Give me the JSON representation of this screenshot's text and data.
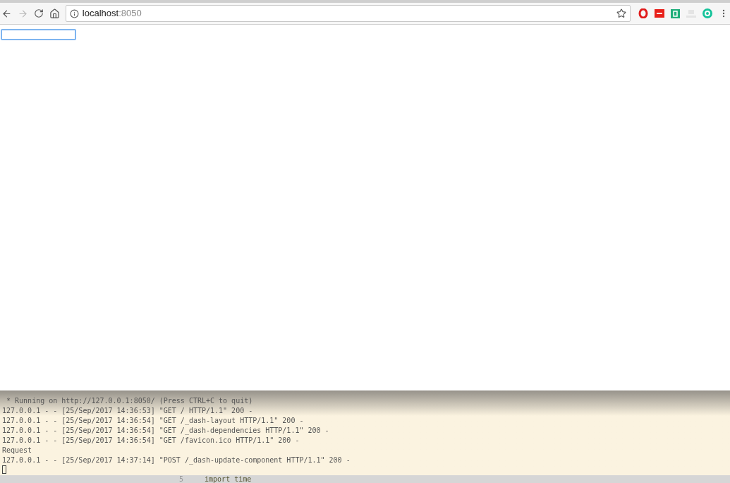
{
  "browser": {
    "address": {
      "host": "localhost",
      "port": ":8050"
    }
  },
  "page": {
    "input": {
      "focused": true
    }
  },
  "terminal": {
    "lines": [
      " * Running on http://127.0.0.1:8050/ (Press CTRL+C to quit)",
      "127.0.0.1 - - [25/Sep/2017 14:36:53] \"GET / HTTP/1.1\" 200 -",
      "127.0.0.1 - - [25/Sep/2017 14:36:54] \"GET /_dash-layout HTTP/1.1\" 200 -",
      "127.0.0.1 - - [25/Sep/2017 14:36:54] \"GET /_dash-dependencies HTTP/1.1\" 200 -",
      "127.0.0.1 - - [25/Sep/2017 14:36:54] \"GET /favicon.ico HTTP/1.1\" 200 -",
      "Request",
      "127.0.0.1 - - [25/Sep/2017 14:37:14] \"POST /_dash-update-component HTTP/1.1\" 200 -"
    ]
  },
  "editor": {
    "line_number": "5",
    "code": "import time"
  }
}
